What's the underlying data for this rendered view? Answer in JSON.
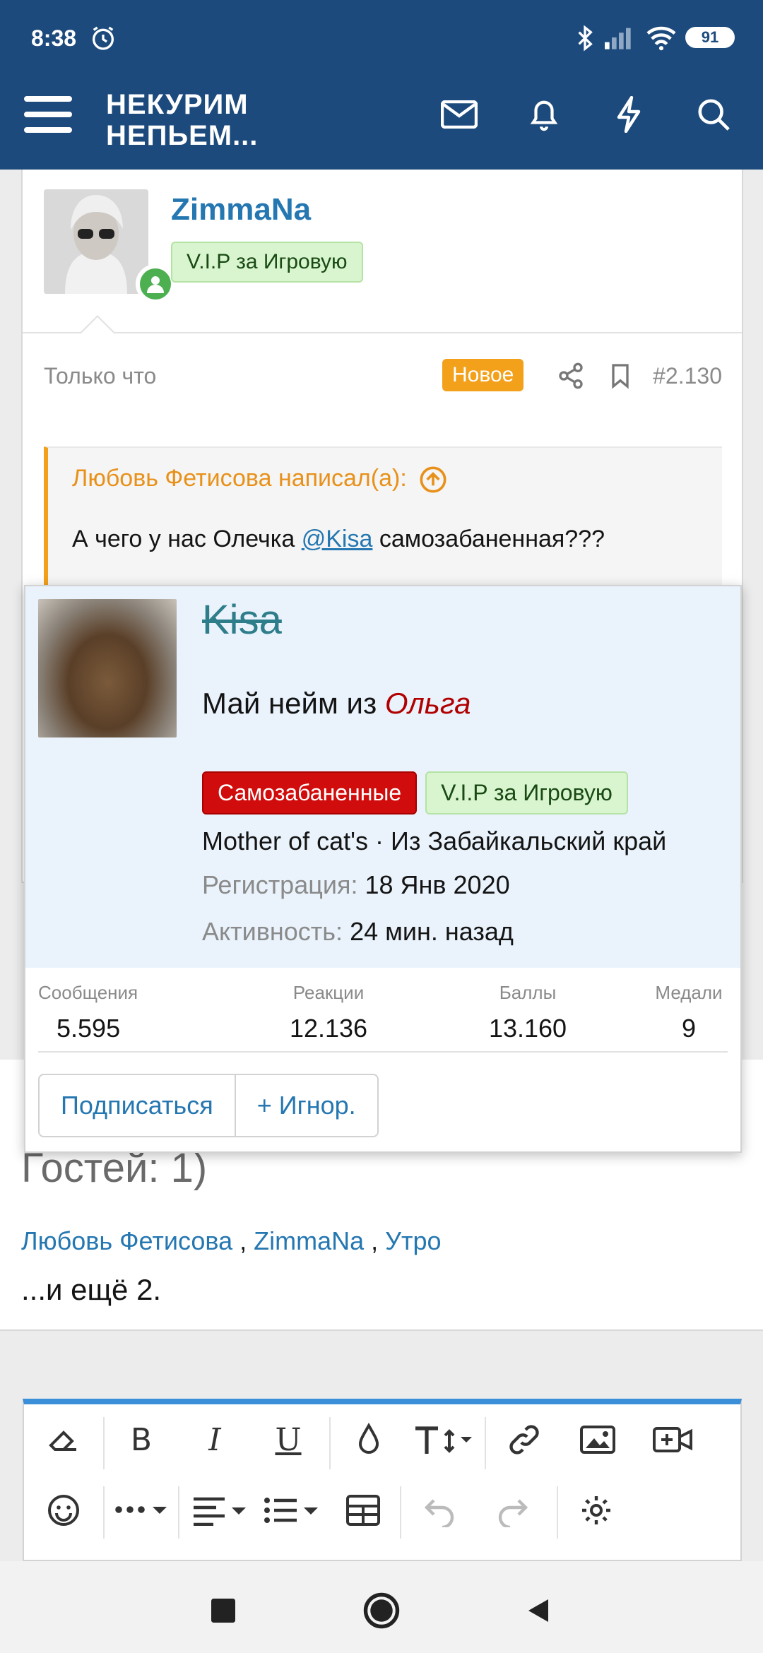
{
  "status_bar": {
    "time": "8:38",
    "battery": "91"
  },
  "header": {
    "logo_line1": "НЕКУРИМ",
    "logo_line2": "НЕПЬЕМ..."
  },
  "post": {
    "author": "ZimmaNa",
    "author_badge": "V.I.P за Игровую",
    "time": "Только что",
    "new_badge": "Новое",
    "number": "#2.130",
    "quote": {
      "header": "Любовь Фетисова написал(а):",
      "text_before": "А чего у нас Олечка ",
      "mention": "@Kisa",
      "text_after": " самозабаненная???"
    }
  },
  "popup": {
    "name": "Kisa",
    "title_prefix": "Май нейм из ",
    "title_name": "Ольга",
    "badges": [
      "Самозабаненные",
      "V.I.P за Игровую"
    ],
    "about": "Mother of cat's · Из Забайкальский край",
    "reg_label": "Регистрация:",
    "reg_value": "18 Янв 2020",
    "activity_label": "Активность:",
    "activity_value": "24 мин. назад",
    "stats": [
      {
        "label": "Сообщения",
        "value": "5.595"
      },
      {
        "label": "Реакции",
        "value": "12.136"
      },
      {
        "label": "Баллы",
        "value": "13.160"
      },
      {
        "label": "Медали",
        "value": "9"
      }
    ],
    "buttons": {
      "follow": "Подписаться",
      "ignore": "+ Игнор."
    }
  },
  "online": {
    "guests": "Гостей: 1)",
    "users": [
      "Любовь Фетисова",
      "ZimmaNa",
      "Утро"
    ],
    "sep": " , ",
    "more": "...и ещё 2."
  },
  "colors": {
    "header": "#1c4a7c",
    "link": "#2577b1",
    "accent": "#f3a01a",
    "banned": "#d10c0c"
  }
}
